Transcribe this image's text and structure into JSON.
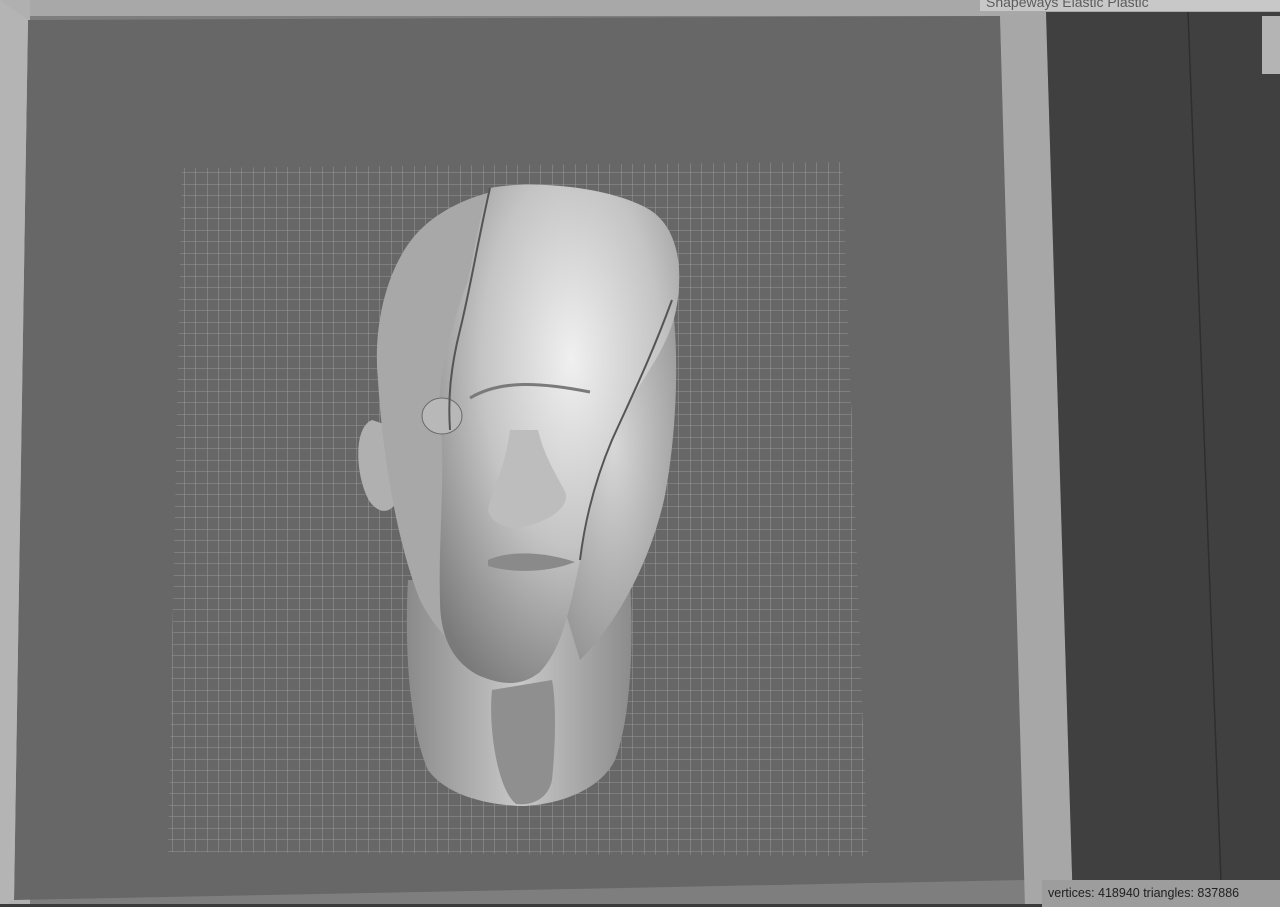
{
  "window": {
    "title_partial": "Shapeways Elastic Plastic"
  },
  "model": {
    "icon": "anatomy-head-model-icon"
  },
  "status": {
    "text": "vertices: 418940 triangles: 837886"
  },
  "colors": {
    "viewport_background": "#666666",
    "side_wall_light": "#a6a6a6",
    "side_wall_dark": "#404040",
    "grid_line": "#d8d8d8",
    "model_surface": "#c8c8c8"
  }
}
